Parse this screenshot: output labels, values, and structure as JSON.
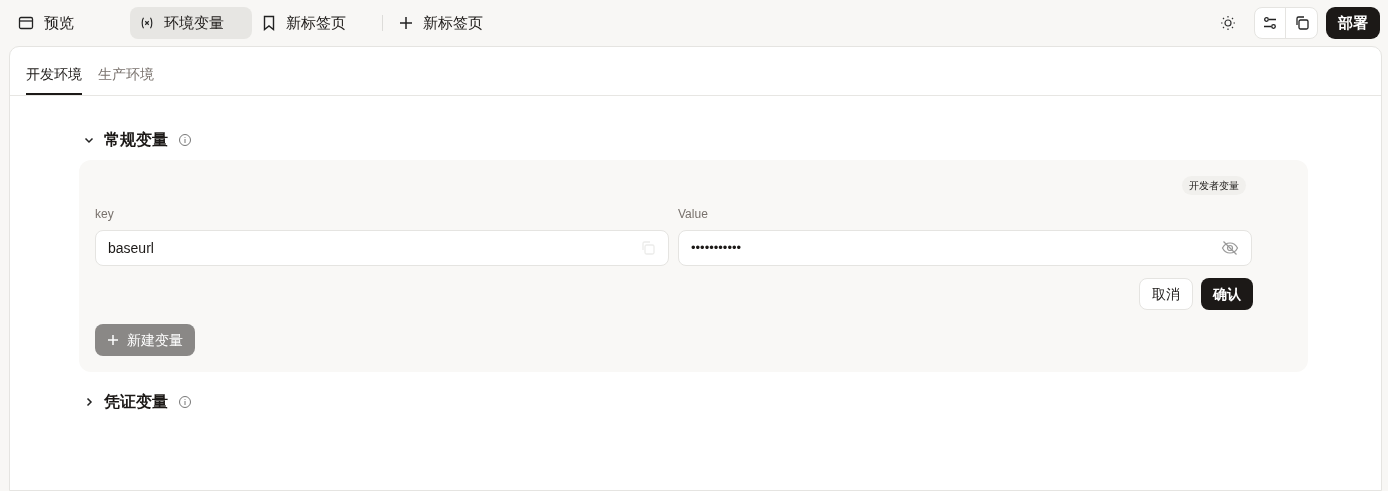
{
  "top_tabs": [
    {
      "kind": "preview",
      "label": "预览",
      "selected": false
    },
    {
      "kind": "variables",
      "label": "环境变量",
      "selected": true
    },
    {
      "kind": "bookmark",
      "label": "新标签页",
      "selected": false
    },
    {
      "kind": "add",
      "label": "新标签页",
      "selected": false
    }
  ],
  "deploy_button": "部署",
  "env_tabs": [
    {
      "label": "开发环境",
      "selected": true
    },
    {
      "label": "生产环境",
      "selected": false
    }
  ],
  "sections": [
    {
      "title": "常规变量",
      "expanded": true,
      "panel": {
        "badge": "开发者变量",
        "key_label": "key",
        "key_value": "baseurl",
        "value_label": "Value",
        "value": "•••••••••••",
        "cancel": "取消",
        "confirm": "确认",
        "new_variable": "新建变量"
      }
    },
    {
      "title": "凭证变量",
      "expanded": false
    }
  ]
}
